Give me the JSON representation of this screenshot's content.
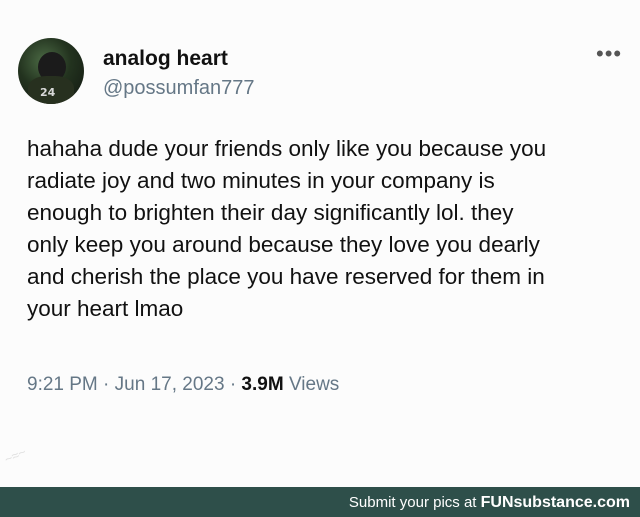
{
  "tweet": {
    "display_name": "analog heart",
    "handle": "@possumfan777",
    "avatar_number": "24",
    "more_icon": "more-horizontal-icon",
    "lines": [
      "hahaha dude your friends only like you because you",
      "radiate joy and two minutes in your company is",
      "enough to brighten their day significantly lol. they",
      "only keep you around because they love you dearly",
      "and cherish the place you have reserved for them in",
      "your heart lmao"
    ],
    "time": "9:21 PM",
    "separator": "·",
    "date": "Jun 17, 2023",
    "views_count": "3.9M",
    "views_label": "Views"
  },
  "footer": {
    "prefix": "Submit your pics at ",
    "brand": "FUNsubstance.com"
  },
  "colors": {
    "footer_bg": "#2e4f4a",
    "secondary_text": "#657786"
  }
}
